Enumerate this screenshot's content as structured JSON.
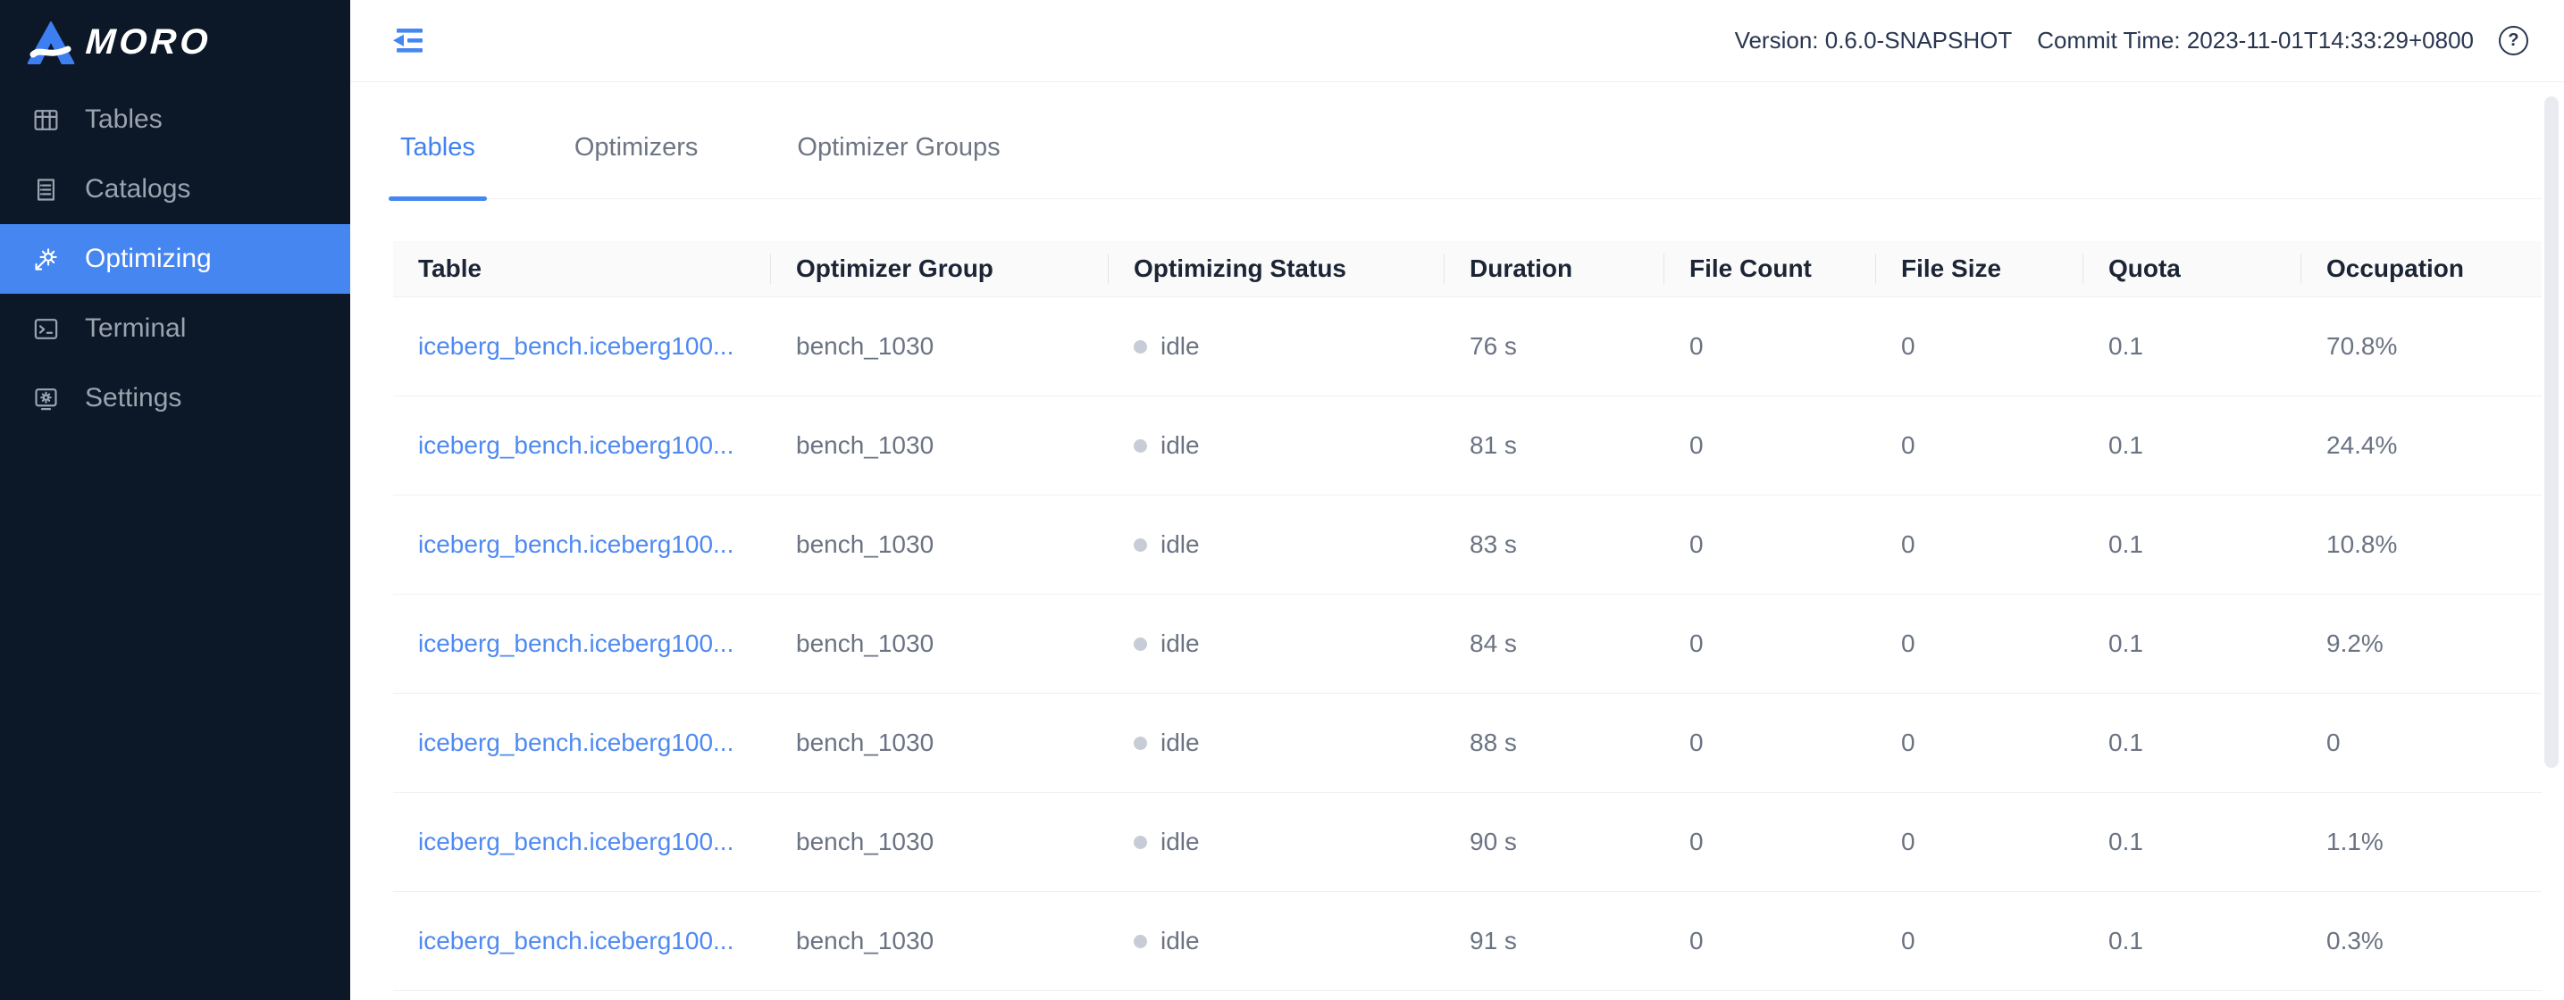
{
  "app": {
    "logo_text": "MORO"
  },
  "topbar": {
    "version_label": "Version: 0.6.0-SNAPSHOT",
    "commit_label": "Commit Time: 2023-11-01T14:33:29+0800",
    "help_glyph": "?"
  },
  "sidebar": {
    "items": [
      {
        "label": "Tables",
        "icon": "table-grid-icon",
        "active": false
      },
      {
        "label": "Catalogs",
        "icon": "catalog-document-icon",
        "active": false
      },
      {
        "label": "Optimizing",
        "icon": "optimizing-gear-icon",
        "active": true
      },
      {
        "label": "Terminal",
        "icon": "terminal-icon",
        "active": false
      },
      {
        "label": "Settings",
        "icon": "settings-monitor-icon",
        "active": false
      }
    ]
  },
  "tabs": [
    {
      "label": "Tables",
      "active": true
    },
    {
      "label": "Optimizers",
      "active": false
    },
    {
      "label": "Optimizer Groups",
      "active": false
    }
  ],
  "table": {
    "columns": [
      "Table",
      "Optimizer Group",
      "Optimizing Status",
      "Duration",
      "File Count",
      "File Size",
      "Quota",
      "Occupation"
    ],
    "rows": [
      {
        "table": "iceberg_bench.iceberg100...",
        "group": "bench_1030",
        "status": "idle",
        "duration": "76 s",
        "file_count": "0",
        "file_size": "0",
        "quota": "0.1",
        "occupation": "70.8%"
      },
      {
        "table": "iceberg_bench.iceberg100...",
        "group": "bench_1030",
        "status": "idle",
        "duration": "81 s",
        "file_count": "0",
        "file_size": "0",
        "quota": "0.1",
        "occupation": "24.4%"
      },
      {
        "table": "iceberg_bench.iceberg100...",
        "group": "bench_1030",
        "status": "idle",
        "duration": "83 s",
        "file_count": "0",
        "file_size": "0",
        "quota": "0.1",
        "occupation": "10.8%"
      },
      {
        "table": "iceberg_bench.iceberg100...",
        "group": "bench_1030",
        "status": "idle",
        "duration": "84 s",
        "file_count": "0",
        "file_size": "0",
        "quota": "0.1",
        "occupation": "9.2%"
      },
      {
        "table": "iceberg_bench.iceberg100...",
        "group": "bench_1030",
        "status": "idle",
        "duration": "88 s",
        "file_count": "0",
        "file_size": "0",
        "quota": "0.1",
        "occupation": "0"
      },
      {
        "table": "iceberg_bench.iceberg100...",
        "group": "bench_1030",
        "status": "idle",
        "duration": "90 s",
        "file_count": "0",
        "file_size": "0",
        "quota": "0.1",
        "occupation": "1.1%"
      },
      {
        "table": "iceberg_bench.iceberg100...",
        "group": "bench_1030",
        "status": "idle",
        "duration": "91 s",
        "file_count": "0",
        "file_size": "0",
        "quota": "0.1",
        "occupation": "0.3%"
      }
    ]
  },
  "colors": {
    "accent": "#4586f0",
    "link": "#4f8af2",
    "sidebar_bg": "#0c1828",
    "status_dot": "#c8ccd6"
  }
}
